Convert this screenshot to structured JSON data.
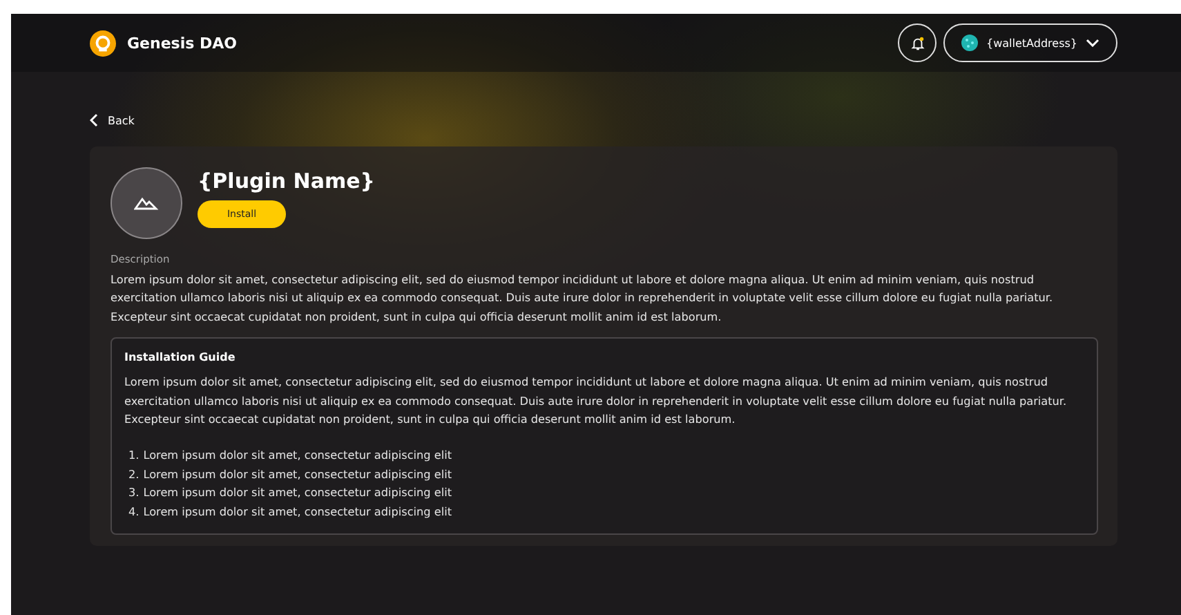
{
  "header": {
    "brand": "Genesis DAO",
    "wallet": "{walletAddress}"
  },
  "back": "Back",
  "plugin": {
    "name": "{Plugin Name}",
    "install": "Install",
    "description_label": "Description",
    "description": "Lorem ipsum dolor sit amet, consectetur adipiscing elit, sed do eiusmod tempor incididunt ut labore et dolore magna aliqua. Ut enim ad minim veniam, quis nostrud exercitation ullamco laboris nisi ut aliquip ex ea commodo consequat. Duis aute irure dolor in reprehenderit in voluptate velit esse cillum dolore eu fugiat nulla pariatur. Excepteur sint occaecat cupidatat non proident, sunt in culpa qui officia deserunt mollit anim id est laborum."
  },
  "guide": {
    "title": "Installation Guide",
    "text": "Lorem ipsum dolor sit amet, consectetur adipiscing elit, sed do eiusmod tempor incididunt ut labore et dolore magna aliqua. Ut enim ad minim veniam, quis nostrud exercitation ullamco laboris nisi ut aliquip ex ea commodo consequat. Duis aute irure dolor in reprehenderit in voluptate velit esse cillum dolore eu fugiat nulla pariatur. Excepteur sint occaecat cupidatat non proident, sunt in culpa qui officia deserunt mollit anim id est laborum.",
    "steps": [
      {
        "number": "1.",
        "text": "Lorem ipsum dolor sit amet, consectetur adipiscing elit"
      },
      {
        "number": "2.",
        "text": "Lorem ipsum dolor sit amet, consectetur adipiscing elit"
      },
      {
        "number": "3.",
        "text": "Lorem ipsum dolor sit amet, consectetur adipiscing elit"
      },
      {
        "number": "4.",
        "text": "Lorem ipsum dolor sit amet, consectetur adipiscing elit"
      }
    ]
  }
}
